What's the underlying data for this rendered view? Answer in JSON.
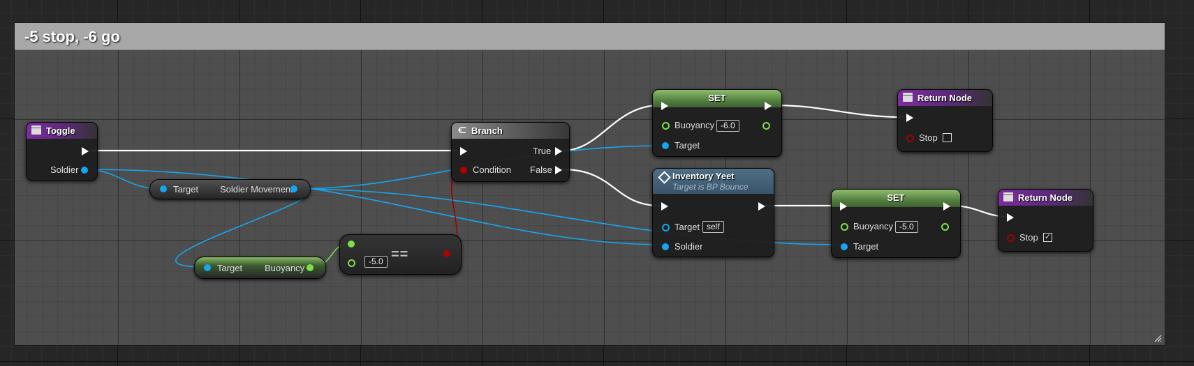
{
  "comment": {
    "title": "-5 stop, -6 go"
  },
  "toggle": {
    "title": "Toggle",
    "soldier_label": "Soldier"
  },
  "get_soldier_movement": {
    "target_label": "Target",
    "output_label": "Soldier Movement"
  },
  "get_buoyancy": {
    "target_label": "Target",
    "output_label": "Buoyancy"
  },
  "equal": {
    "value": "-5.0",
    "symbol": "=="
  },
  "branch": {
    "title": "Branch",
    "true_label": "True",
    "false_label": "False",
    "condition_label": "Condition"
  },
  "set_top": {
    "title": "SET",
    "buoyancy_label": "Buoyancy",
    "buoyancy_value": "-6.0",
    "target_label": "Target"
  },
  "return_top": {
    "title": "Return Node",
    "stop_label": "Stop",
    "stop_checked": ""
  },
  "inventory_yeet": {
    "title": "Inventory Yeet",
    "subtitle": "Target is BP Bounce",
    "target_label": "Target",
    "target_value": "self",
    "soldier_label": "Soldier"
  },
  "set_bottom": {
    "title": "SET",
    "buoyancy_label": "Buoyancy",
    "buoyancy_value": "-5.0",
    "target_label": "Target"
  },
  "return_bottom": {
    "title": "Return Node",
    "stop_label": "Stop",
    "stop_checked": "✓"
  },
  "colors": {
    "exec": "#ffffff",
    "object": "#16a5f0",
    "float": "#7de04a",
    "bool": "#a00000",
    "function_header": "#7c2c9e",
    "set_header": "#54803f"
  }
}
